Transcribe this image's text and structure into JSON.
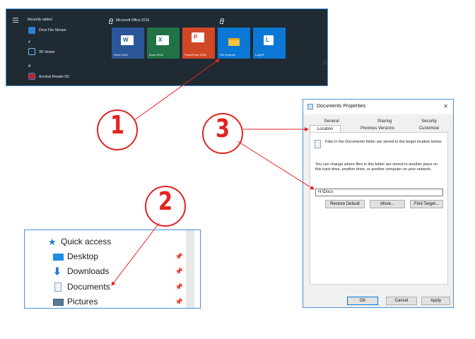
{
  "start_menu": {
    "section_recent": "Recently added",
    "apps": [
      {
        "label": "Drive File Stream",
        "icon": "drive-icon"
      },
      {
        "label": "3D Viewer",
        "icon": "3d-viewer-icon"
      },
      {
        "label": "Acrobat Reader DC",
        "icon": "acrobat-icon"
      }
    ],
    "letter_hash": "#",
    "letter_a": "A",
    "group_title": "Microsoft Office 2016",
    "tiles": [
      {
        "label": "Word 2016",
        "letter": "W",
        "color": "#2b579a"
      },
      {
        "label": "Excel 2016",
        "letter": "X",
        "color": "#217346"
      },
      {
        "label": "PowerPoint 2016",
        "letter": "P",
        "color": "#d24726"
      },
      {
        "label": "File Explorer",
        "letter": "",
        "color": "#0a78d4"
      },
      {
        "label": "LogOff",
        "letter": "L",
        "color": "#0a78d4"
      }
    ],
    "edge_char": "n"
  },
  "quick_access": {
    "header": "Quick access",
    "items": [
      {
        "label": "Desktop",
        "icon": "desktop-icon"
      },
      {
        "label": "Downloads",
        "icon": "downloads-icon"
      },
      {
        "label": "Documents",
        "icon": "documents-icon"
      },
      {
        "label": "Pictures",
        "icon": "pictures-icon"
      }
    ]
  },
  "dialog": {
    "title": "Documents Properties",
    "close_glyph": "✕",
    "tabs_row1": [
      "General",
      "Sharing",
      "Security"
    ],
    "tabs_row2": [
      "Location",
      "Previous Versions",
      "Customize"
    ],
    "info_text": "Files in the Documents folder are stored in the target location below.",
    "change_text": "You can change where files in this folder are stored to another place on this hard drive, another drive, or another computer on your network.",
    "path_value": "H:\\Docs",
    "buttons": {
      "restore": "Restore Default",
      "move": "Move...",
      "find": "Find Target..."
    },
    "footer": {
      "ok": "OK",
      "cancel": "Cancel",
      "apply": "Apply"
    }
  },
  "callouts": [
    "1",
    "2",
    "3"
  ],
  "colors": {
    "accent_red": "#e32320",
    "frame_blue": "#4a90d9"
  }
}
